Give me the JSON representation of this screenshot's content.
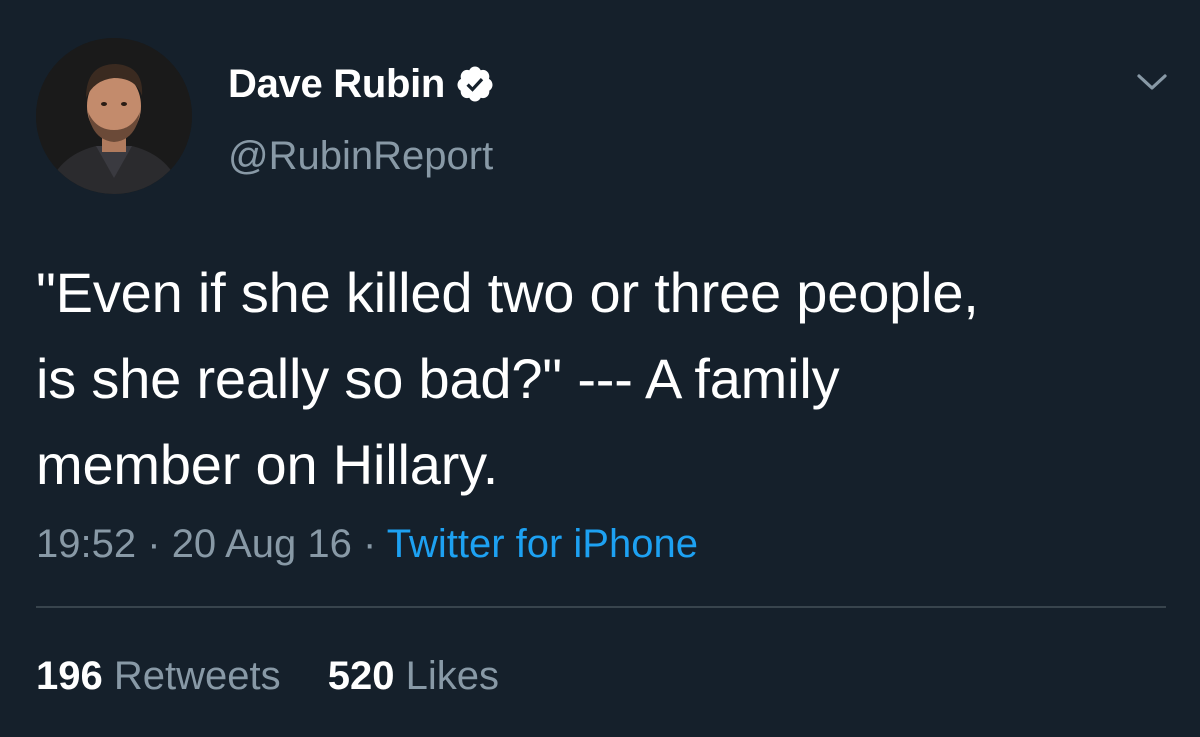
{
  "user": {
    "display_name": "Dave Rubin",
    "handle": "@RubinReport",
    "verified": true
  },
  "tweet": {
    "text": "\"Even if she killed two or three people,\nis she really so bad?\" --- A family\nmember on Hillary.",
    "time": "19:52",
    "date": "20 Aug 16",
    "separator": "·",
    "source": "Twitter for iPhone"
  },
  "stats": {
    "retweets_count": "196",
    "retweets_label": "Retweets",
    "likes_count": "520",
    "likes_label": "Likes"
  },
  "icons": {
    "verified": "verified-badge-icon",
    "menu": "chevron-down-icon"
  },
  "colors": {
    "background": "#15202b",
    "text_primary": "#ffffff",
    "text_secondary": "#8899a6",
    "link": "#1da1f2",
    "divider": "#38444d"
  }
}
